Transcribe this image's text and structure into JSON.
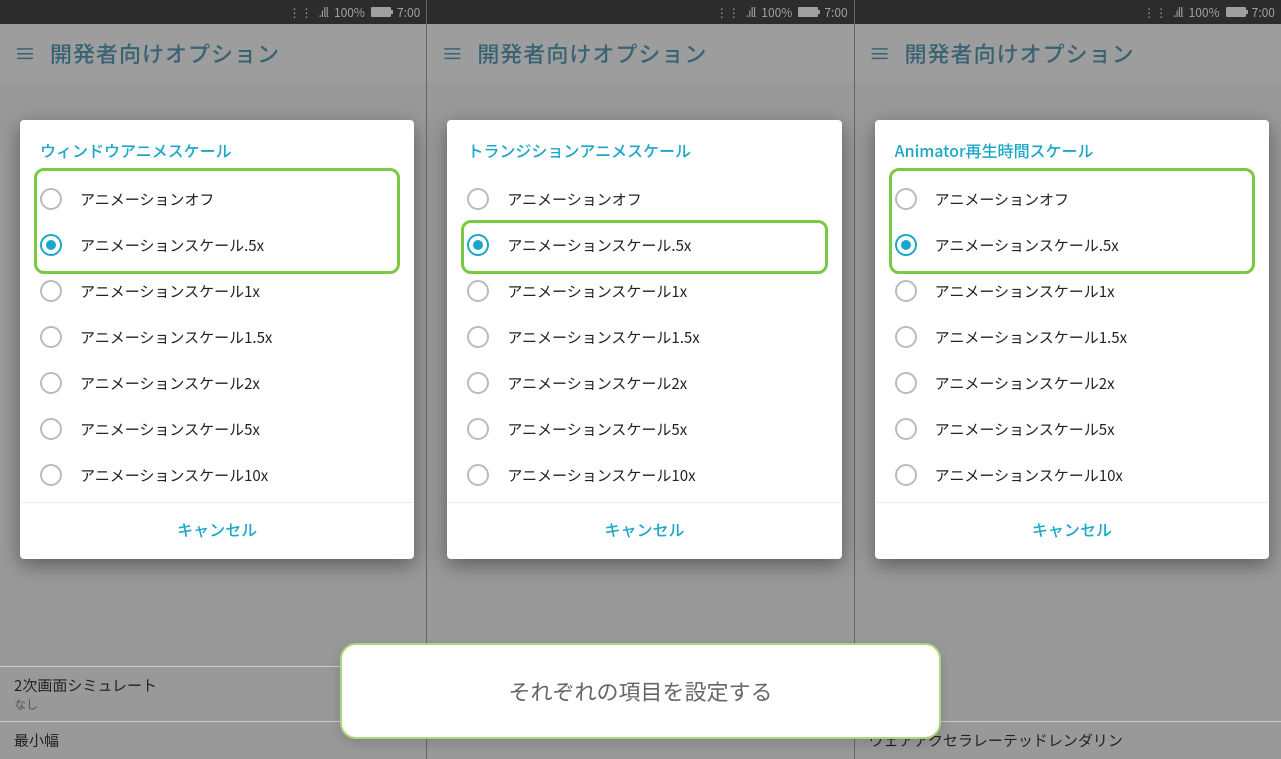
{
  "statusbar": {
    "signal": ".ıll",
    "battery_pct": "100%",
    "time": "7:00"
  },
  "appbar": {
    "title": "開発者向けオプション"
  },
  "dialogs": [
    {
      "title": "ウィンドウアニメスケール",
      "highlight": "two",
      "cancel": "キャンセル"
    },
    {
      "title": "トランジションアニメスケール",
      "highlight": "single",
      "cancel": "キャンセル"
    },
    {
      "title": "Animator再生時間スケール",
      "highlight": "two",
      "cancel": "キャンセル"
    }
  ],
  "options": [
    "アニメーションオフ",
    "アニメーションスケール.5x",
    "アニメーションスケール1x",
    "アニメーションスケール1.5x",
    "アニメーションスケール2x",
    "アニメーションスケール5x",
    "アニメーションスケール10x"
  ],
  "selected_index": 1,
  "peek_rows": {
    "sim": {
      "label": "2次画面シミュレート",
      "sub": "なし"
    },
    "minw": {
      "label": "最小幅"
    },
    "row3": {
      "label": "ウェアアクセラレーテッドレンダリン"
    }
  },
  "annotation": "それぞれの項目を設定する"
}
